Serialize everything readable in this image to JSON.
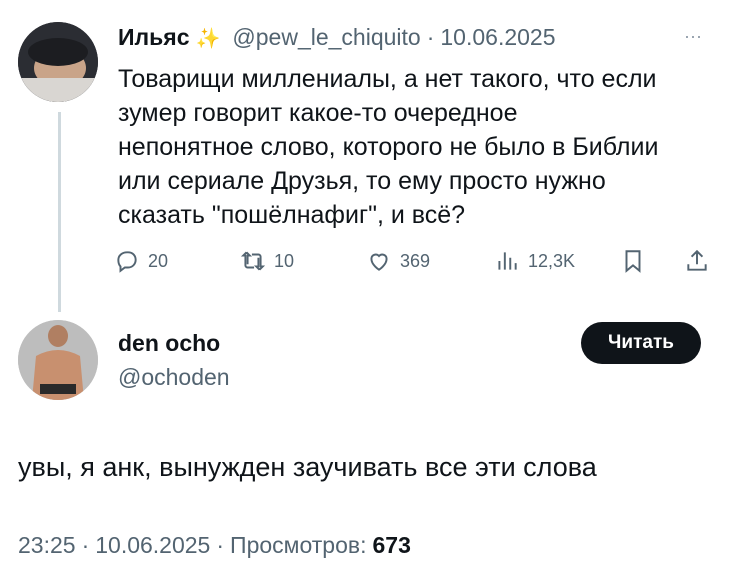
{
  "tweet": {
    "author_name": "Ильяс",
    "author_emoji": "✨",
    "handle": "@pew_le_chiquito",
    "separator": "·",
    "date": "10.06.2025",
    "more": "···",
    "text_lines": [
      "Товарищи миллениалы, а нет такого, что если",
      "зумер говорит какое-то очередное",
      "непонятное слово, которого не было в Библии",
      "или сериале Друзья, то ему просто нужно",
      "сказать \"пошёлнафиг\", и всё?"
    ],
    "stats": {
      "replies": "20",
      "retweets": "10",
      "likes": "369",
      "views": "12,3K"
    }
  },
  "reply": {
    "author_name": "den ocho",
    "handle": "@ochoden",
    "follow_label": "Читать",
    "text": "увы, я анк, вынужден заучивать все эти слова",
    "time": "23:25",
    "separator1": "·",
    "date": "10.06.2025",
    "separator2": "·",
    "views_label": "Просмотров:",
    "views_count": "673"
  },
  "colors": {
    "text": "#0f1419",
    "secondary": "#536471",
    "button_bg": "#0f1419",
    "thread_line": "#cfd9de"
  },
  "icons": [
    "reply-icon",
    "retweet-icon",
    "like-icon",
    "views-icon",
    "bookmark-icon",
    "share-icon",
    "sparkles-icon",
    "more-icon"
  ]
}
